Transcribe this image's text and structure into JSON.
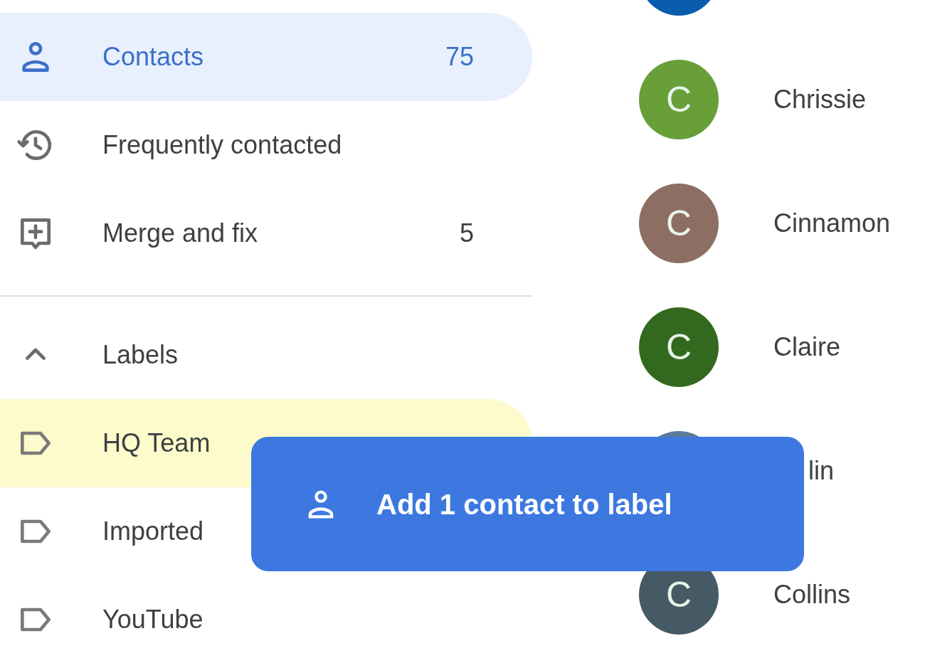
{
  "sidebar": {
    "items": [
      {
        "kind": "contacts",
        "label": "Contacts",
        "count": "75",
        "selected": true
      },
      {
        "kind": "frequent",
        "label": "Frequently contacted",
        "selected": false
      },
      {
        "kind": "merge",
        "label": "Merge and fix",
        "count": "5",
        "selected": false
      }
    ],
    "labels_section": {
      "title": "Labels",
      "expanded": true,
      "items": [
        {
          "label": "HQ Team",
          "drop_target": true
        },
        {
          "label": "Imported",
          "drop_target": false
        },
        {
          "label": "YouTube",
          "drop_target": false
        }
      ]
    }
  },
  "contacts": [
    {
      "color": "#0b5cad"
    },
    {
      "initial": "C",
      "name": "Chrissie",
      "color": "#689f38"
    },
    {
      "initial": "C",
      "name": "Cinnamon",
      "color": "#8d6e63"
    },
    {
      "initial": "C",
      "name": "Claire",
      "color": "#33691e"
    },
    {
      "name": "lin",
      "color": "#5c7a99",
      "covered": true
    },
    {
      "initial": "C",
      "name": "Collins",
      "color": "#455a64"
    }
  ],
  "drag_chip": {
    "label": "Add 1 contact to label"
  }
}
